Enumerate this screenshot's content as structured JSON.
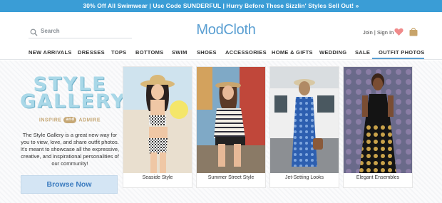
{
  "promo": {
    "text": "30% Off All Swimwear | Use Code SUNDERFUL | Hurry Before These Sizzlin' Styles Sell Out! »"
  },
  "header": {
    "search_placeholder": "Search",
    "logo": "ModCloth",
    "account": "Join | Sign In",
    "heart_icon": "heart-icon",
    "bag_icon": "shopping-bag-icon"
  },
  "nav": {
    "items": [
      "NEW ARRIVALS",
      "DRESSES",
      "TOPS",
      "BOTTOMS",
      "SWIM",
      "SHOES",
      "ACCESSORIES",
      "HOME & GIFTS",
      "WEDDING",
      "SALE",
      "OUTFIT PHOTOS"
    ],
    "active": "OUTFIT PHOTOS"
  },
  "gallery": {
    "title_line1": "STYLE",
    "title_line2": "GALLERY",
    "sub_left": "INSPIRE",
    "sub_amp": "and",
    "sub_right": "ADMIRE",
    "description": "The Style Gallery is a great new way for you to view, love, and share outfit photos. It's meant to showcase all the expressive, creative, and inspirational personalities of our community!",
    "button": "Browse Now"
  },
  "cards": [
    {
      "caption": "Seaside Style"
    },
    {
      "caption": "Summer Street Style"
    },
    {
      "caption": "Jet-Setting Looks"
    },
    {
      "caption": "Elegant Ensembles"
    }
  ],
  "colors": {
    "accent": "#3a9dd6",
    "logo": "#5a9fd2",
    "heart": "#f08a8a",
    "bag": "#c8a46a"
  }
}
